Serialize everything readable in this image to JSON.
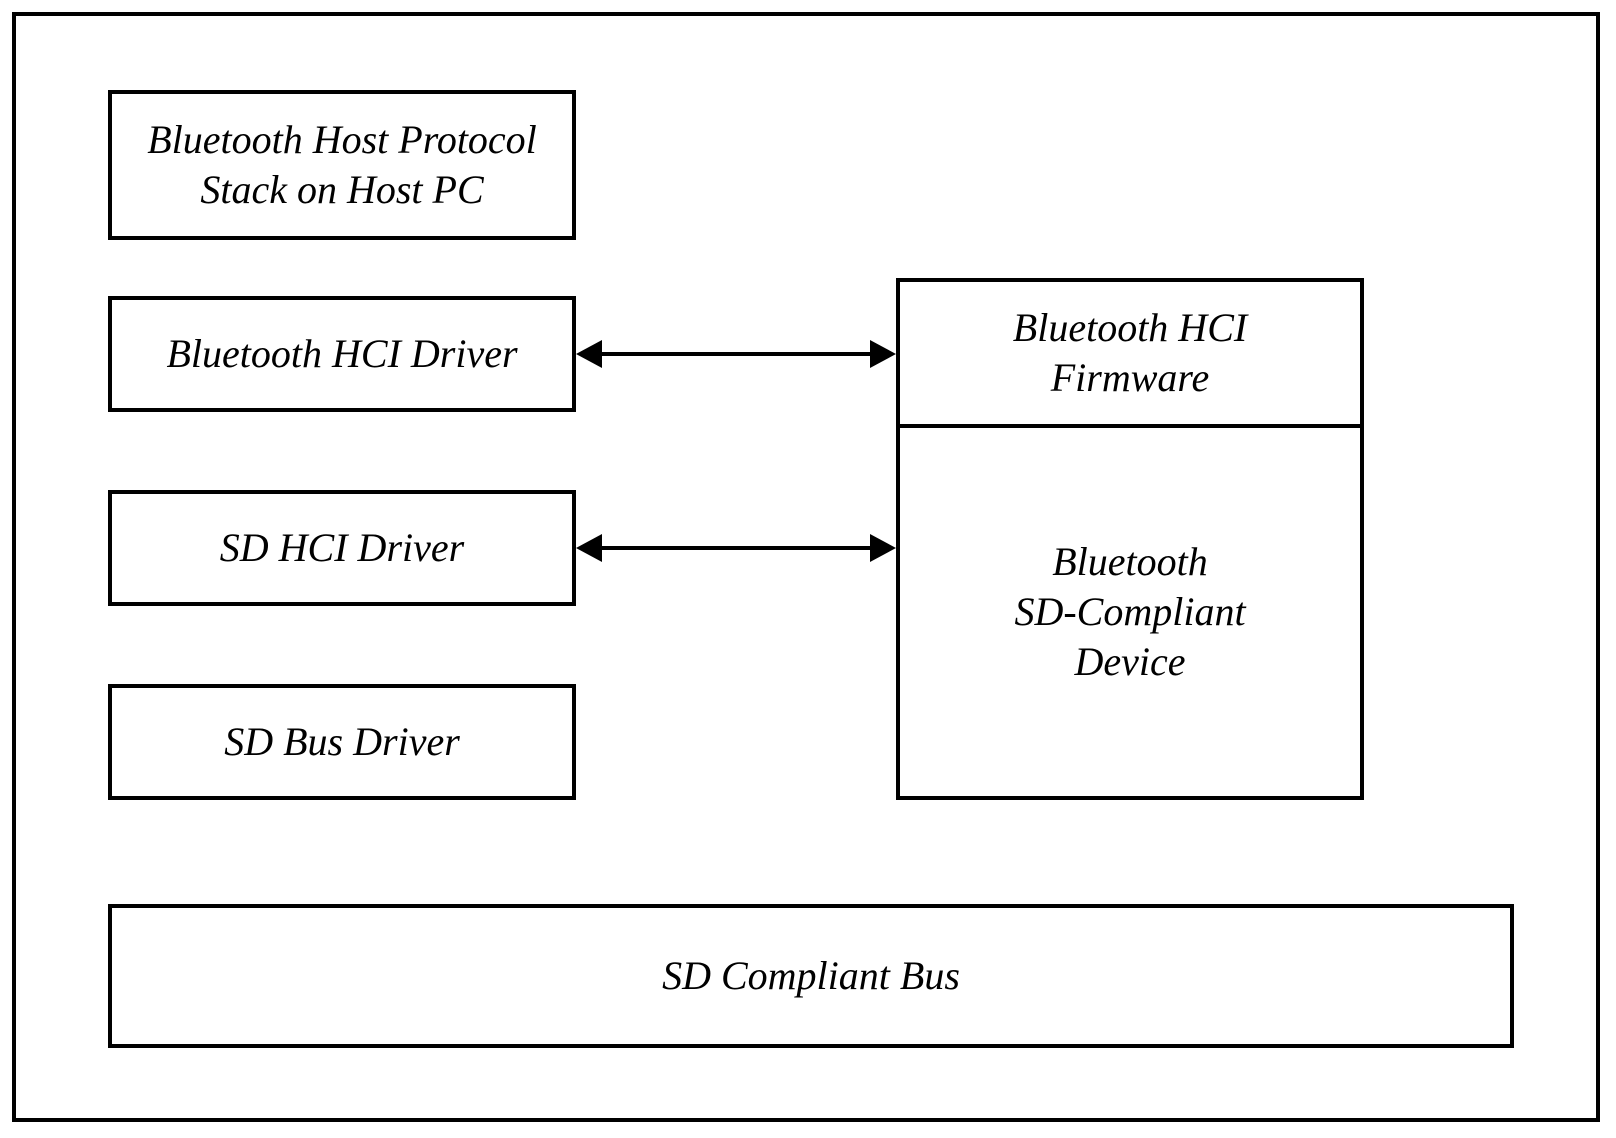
{
  "boxes": {
    "host_protocol_stack": "Bluetooth Host Protocol\nStack on Host PC",
    "bt_hci_driver": "Bluetooth HCI Driver",
    "sd_hci_driver": "SD HCI Driver",
    "sd_bus_driver": "SD Bus Driver",
    "bt_hci_firmware": "Bluetooth HCI\nFirmware",
    "bt_sd_device": "Bluetooth\nSD-Compliant\nDevice",
    "sd_compliant_bus": "SD Compliant Bus"
  }
}
